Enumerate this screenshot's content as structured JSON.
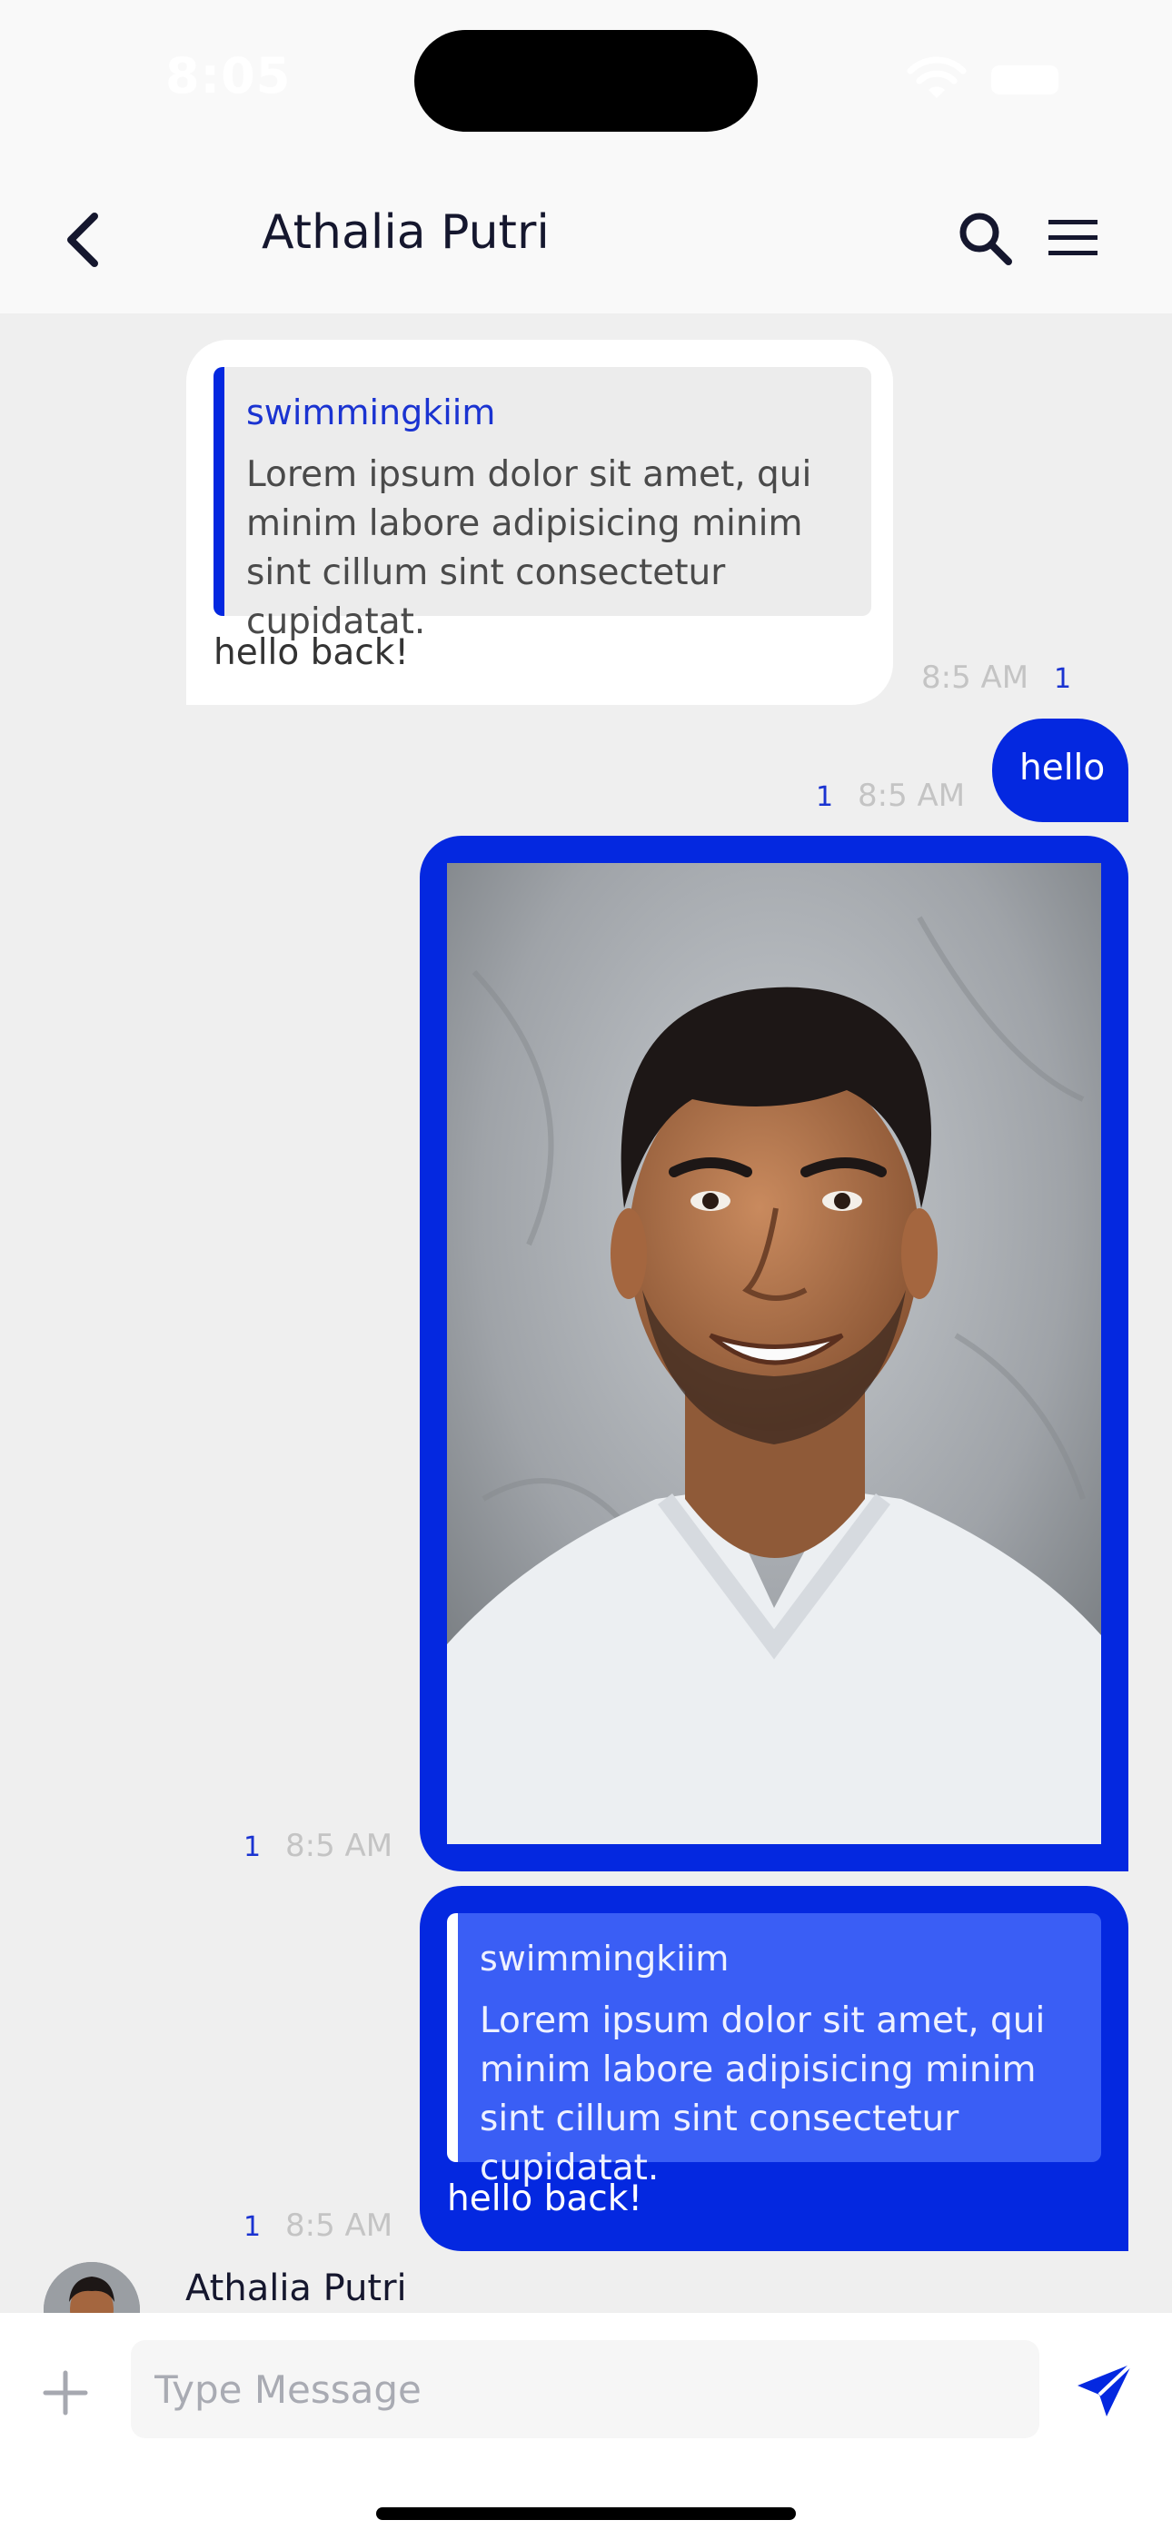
{
  "status_bar": {
    "time": "8:05"
  },
  "header": {
    "title": "Athalia Putri"
  },
  "messages": {
    "m1": {
      "quote_name": "swimmingkiim",
      "quote_text": "Lorem ipsum dolor sit amet, qui minim labore adipisicing minim sint cillum sint consectetur cupidatat.",
      "text": "hello back!",
      "time": "8:5 AM",
      "count": "1"
    },
    "m2": {
      "text": "hello",
      "time": "8:5 AM",
      "count": "1"
    },
    "m3": {
      "image_alt": "portrait photo of smiling man in white t-shirt",
      "time": "8:5 AM",
      "count": "1"
    },
    "m4": {
      "quote_name": "swimmingkiim",
      "quote_text": "Lorem ipsum dolor sit amet, qui minim labore adipisicing minim sint cillum sint consectetur cupidatat.",
      "text": "hello back!",
      "time": "8:5 AM",
      "count": "1"
    },
    "m5": {
      "sender": "Athalia Putri"
    }
  },
  "input": {
    "placeholder": "Type Message"
  },
  "colors": {
    "accent": "#0428e0",
    "quote_out_bg": "#3a5ef5",
    "quote_in_bg": "#ececec",
    "background": "#efefef"
  },
  "icons": {
    "back": "chevron-left-icon",
    "search": "search-icon",
    "menu": "hamburger-menu-icon",
    "add": "plus-icon",
    "send": "send-icon"
  }
}
